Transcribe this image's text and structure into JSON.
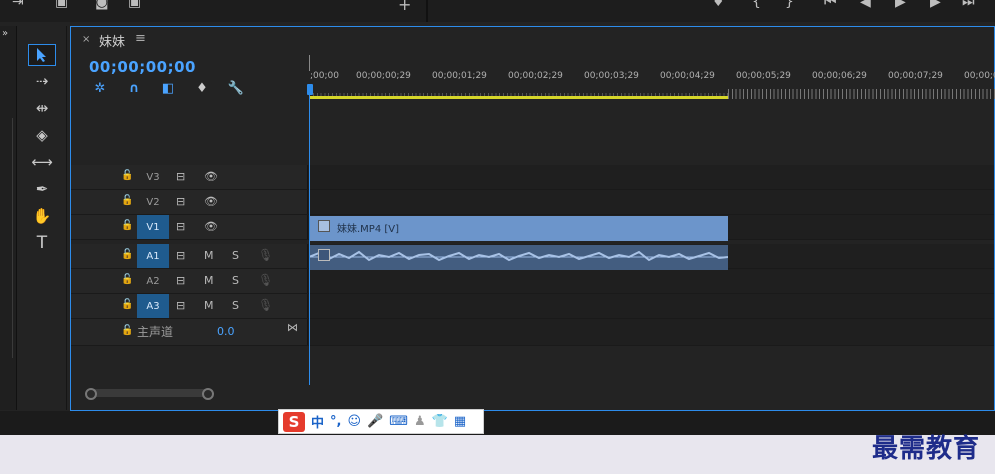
{
  "sequence": {
    "tab_name": "妹妹",
    "close_glyph": "×",
    "menu_glyph": "≡",
    "timecode": "00;00;00;00"
  },
  "ruler": {
    "labels": [
      ";00;00",
      "00;00;00;29",
      "00;00;01;29",
      "00;00;02;29",
      "00;00;03;29",
      "00;00;04;29",
      "00;00;05;29",
      "00;00;06;29",
      "00;00;07;29",
      "00;00;0"
    ]
  },
  "tracks": {
    "video": [
      {
        "name": "V3",
        "targeted": false
      },
      {
        "name": "V2",
        "targeted": false
      },
      {
        "name": "V1",
        "targeted": true
      }
    ],
    "audio": [
      {
        "name": "A1",
        "targeted": true,
        "m": "M",
        "s": "S"
      },
      {
        "name": "A2",
        "targeted": false,
        "m": "M",
        "s": "S"
      },
      {
        "name": "A3",
        "targeted": false,
        "m": "M",
        "s": "S"
      }
    ],
    "master": {
      "name": "主声道",
      "value": "0.0"
    }
  },
  "clips": {
    "video_label": "妹妹.MP4 [V]"
  },
  "ime": {
    "logo": "S",
    "mode": "中",
    "punct": "°,"
  },
  "watermark": "最需教育",
  "colors": {
    "accent": "#2d8ceb",
    "work_area": "#d6d62a",
    "video_clip": "#6c95cb",
    "audio_clip": "#435d80",
    "track_target": "#1f5b8e"
  }
}
